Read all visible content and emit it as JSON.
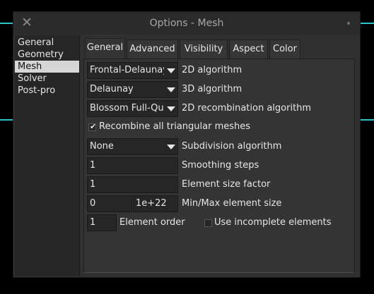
{
  "window": {
    "title": "Options - Mesh",
    "close_glyph": "✕"
  },
  "sidebar": {
    "items": [
      {
        "label": "General"
      },
      {
        "label": "Geometry"
      },
      {
        "label": "Mesh"
      },
      {
        "label": "Solver"
      },
      {
        "label": "Post-pro"
      }
    ],
    "selected": "Mesh"
  },
  "tabs": [
    {
      "label": "General"
    },
    {
      "label": "Advanced"
    },
    {
      "label": "Visibility"
    },
    {
      "label": "Aspect"
    },
    {
      "label": "Color"
    }
  ],
  "active_tab": "General",
  "general": {
    "algo2d": {
      "value": "Frontal-Delaunay",
      "label": "2D algorithm"
    },
    "algo3d": {
      "value": "Delaunay",
      "label": "3D algorithm"
    },
    "recomb_algo": {
      "value": "Blossom Full-Quad",
      "label": "2D recombination algorithm"
    },
    "recombine_all": {
      "label": "Recombine all triangular meshes",
      "checked": true,
      "glyph": "✔"
    },
    "subdivision": {
      "value": "None",
      "label": "Subdivision algorithm"
    },
    "smoothing": {
      "value": "1",
      "label": "Smoothing steps"
    },
    "size_factor": {
      "value": "1",
      "label": "Element size factor"
    },
    "min_size": {
      "value": "0"
    },
    "max_size": {
      "value": "1e+22"
    },
    "minmax_label": "Min/Max element size",
    "order": {
      "value": "1",
      "label": "Element order"
    },
    "incomplete": {
      "label": "Use incomplete elements",
      "checked": false
    }
  },
  "colors": {
    "accent_line": "#2ac4c4",
    "selected_bg": "#d6d6d6"
  }
}
